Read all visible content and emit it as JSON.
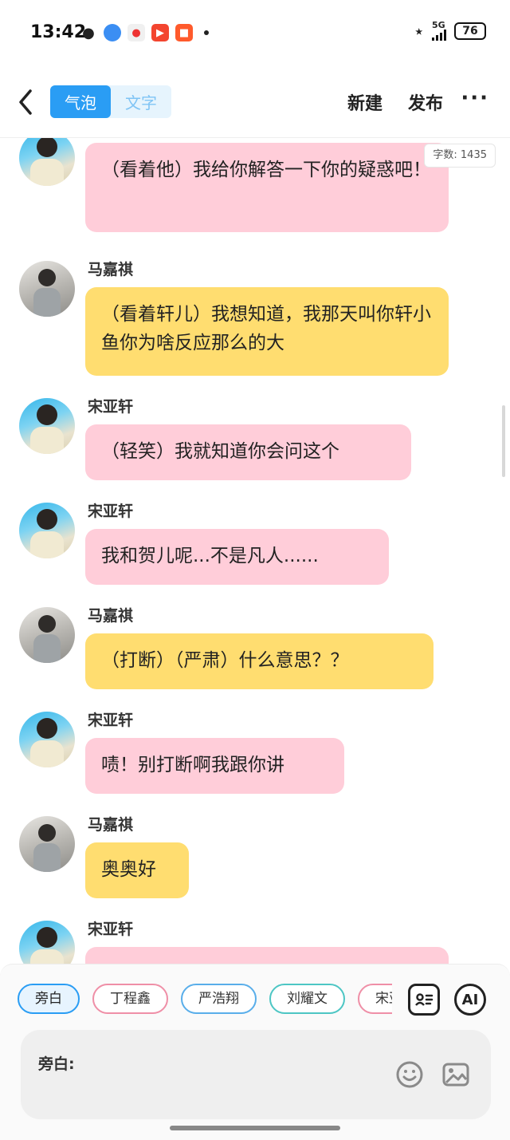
{
  "status_bar": {
    "time": "13:42",
    "network": "5G",
    "battery": "76",
    "left_icons": [
      "wechat-icon",
      "browser-icon",
      "maps-icon",
      "video-icon",
      "app-icon"
    ],
    "right_icons": [
      "bluetooth-icon",
      "signal-icon",
      "battery-icon"
    ]
  },
  "header": {
    "back_icon": "chevron-left-icon",
    "tabs": [
      {
        "label": "气泡",
        "active": true
      },
      {
        "label": "文字",
        "active": false
      }
    ],
    "new_label": "新建",
    "publish_label": "发布",
    "more_label": "···"
  },
  "word_count": "字数: 1435",
  "messages": [
    {
      "speaker": "宋亚轩",
      "show_name": false,
      "text": "（看着他）我给你解答一下你的疑惑吧！",
      "color": "pink"
    },
    {
      "speaker": "马嘉祺",
      "show_name": true,
      "text": "（看着轩儿）我想知道，我那天叫你轩小鱼你为啥反应那么的大",
      "color": "yellow"
    },
    {
      "speaker": "宋亚轩",
      "show_name": true,
      "text": "（轻笑）我就知道你会问这个",
      "color": "pink"
    },
    {
      "speaker": "宋亚轩",
      "show_name": true,
      "text": "我和贺儿呢...不是凡人......",
      "color": "pink"
    },
    {
      "speaker": "马嘉祺",
      "show_name": true,
      "text": "（打断）（严肃）什么意思？？",
      "color": "yellow"
    },
    {
      "speaker": "宋亚轩",
      "show_name": true,
      "text": "啧！别打断啊我跟你讲",
      "color": "pink"
    },
    {
      "speaker": "马嘉祺",
      "show_name": true,
      "text": "奥奥好",
      "color": "yellow"
    },
    {
      "speaker": "宋亚轩",
      "show_name": true,
      "text": "",
      "color": "pink"
    }
  ],
  "colors": {
    "accent": "#2a9df4",
    "bubble_pink": "#ffcdd9",
    "bubble_yellow": "#ffdd70"
  },
  "composer": {
    "roles": [
      "旁白",
      "丁程鑫",
      "严浩翔",
      "刘耀文",
      "宋亚轩"
    ],
    "active_role": "旁白",
    "contacts_icon": "contact-card-icon",
    "ai_label": "AI",
    "input_label": "旁白:",
    "input_value": "",
    "emoji_icon": "emoji-icon",
    "image_icon": "image-icon"
  }
}
